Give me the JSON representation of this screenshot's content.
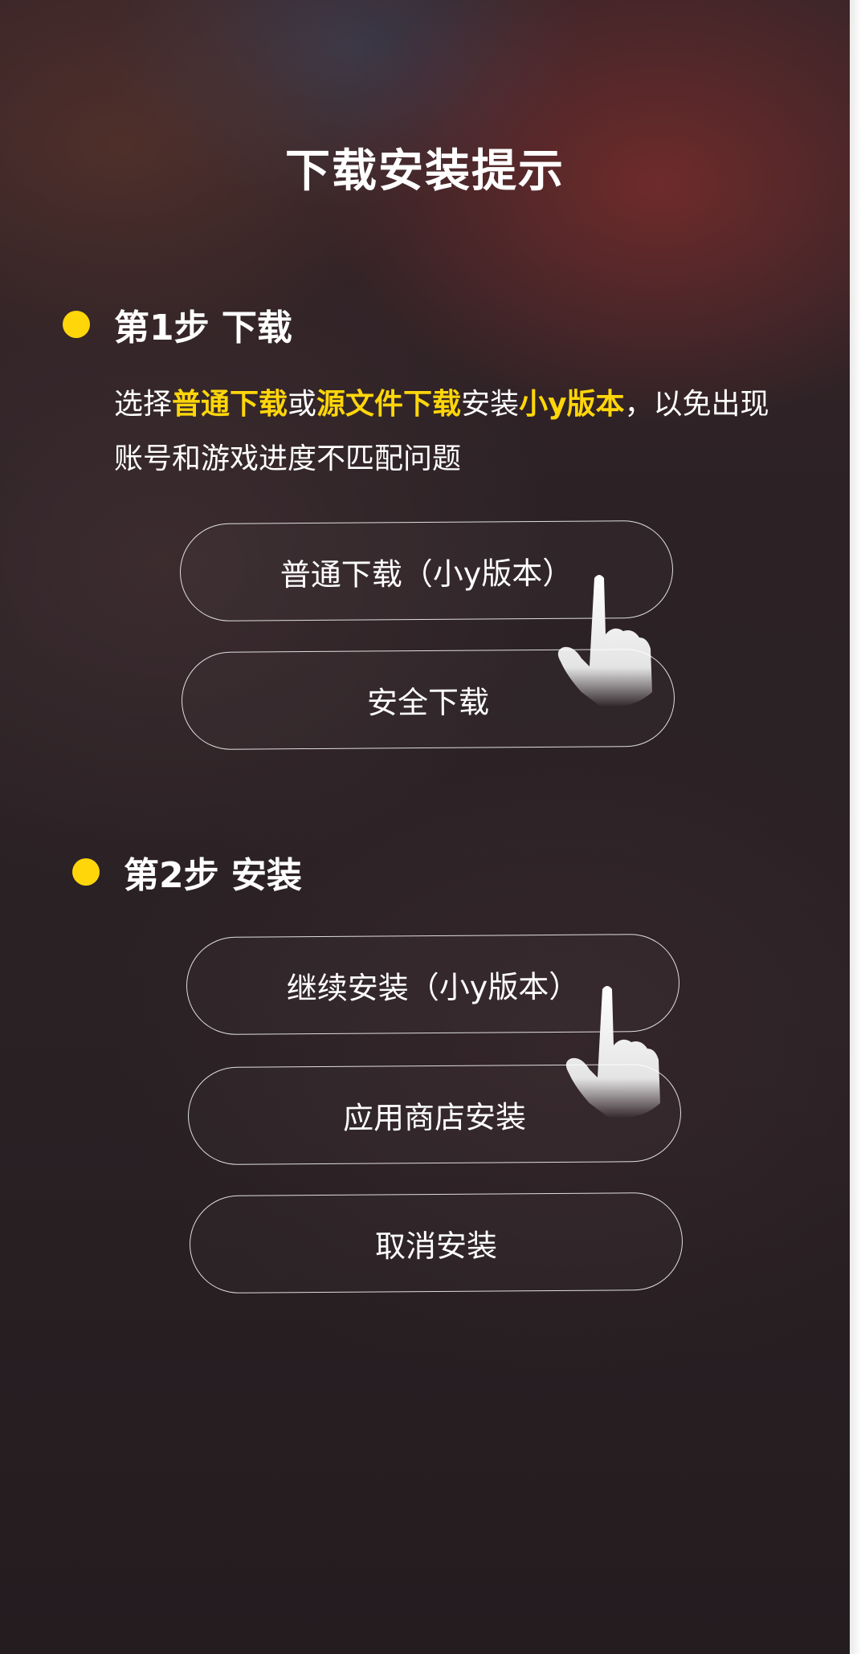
{
  "page": {
    "title": "下载安装提示"
  },
  "step1": {
    "heading": "第1步 下载",
    "description": {
      "p1": "选择",
      "hl1": "普通下载",
      "p2": "或",
      "hl2": "源文件下载",
      "p3": "安装",
      "hl3": "小y版本",
      "p4": "，以免出现账号和游戏进度不匹配问题"
    },
    "buttons": {
      "normal_download": "普通下载（小y版本）",
      "safe_download": "安全下载"
    }
  },
  "step2": {
    "heading": "第2步 安装",
    "buttons": {
      "continue_install": "继续安装（小y版本）",
      "store_install": "应用商店安装",
      "cancel_install": "取消安装"
    }
  },
  "icons": {
    "pointer": "tap-hand-icon",
    "bullet": "yellow-dot-icon"
  },
  "colors": {
    "accent": "#ffd60a",
    "text": "#ffffff"
  }
}
